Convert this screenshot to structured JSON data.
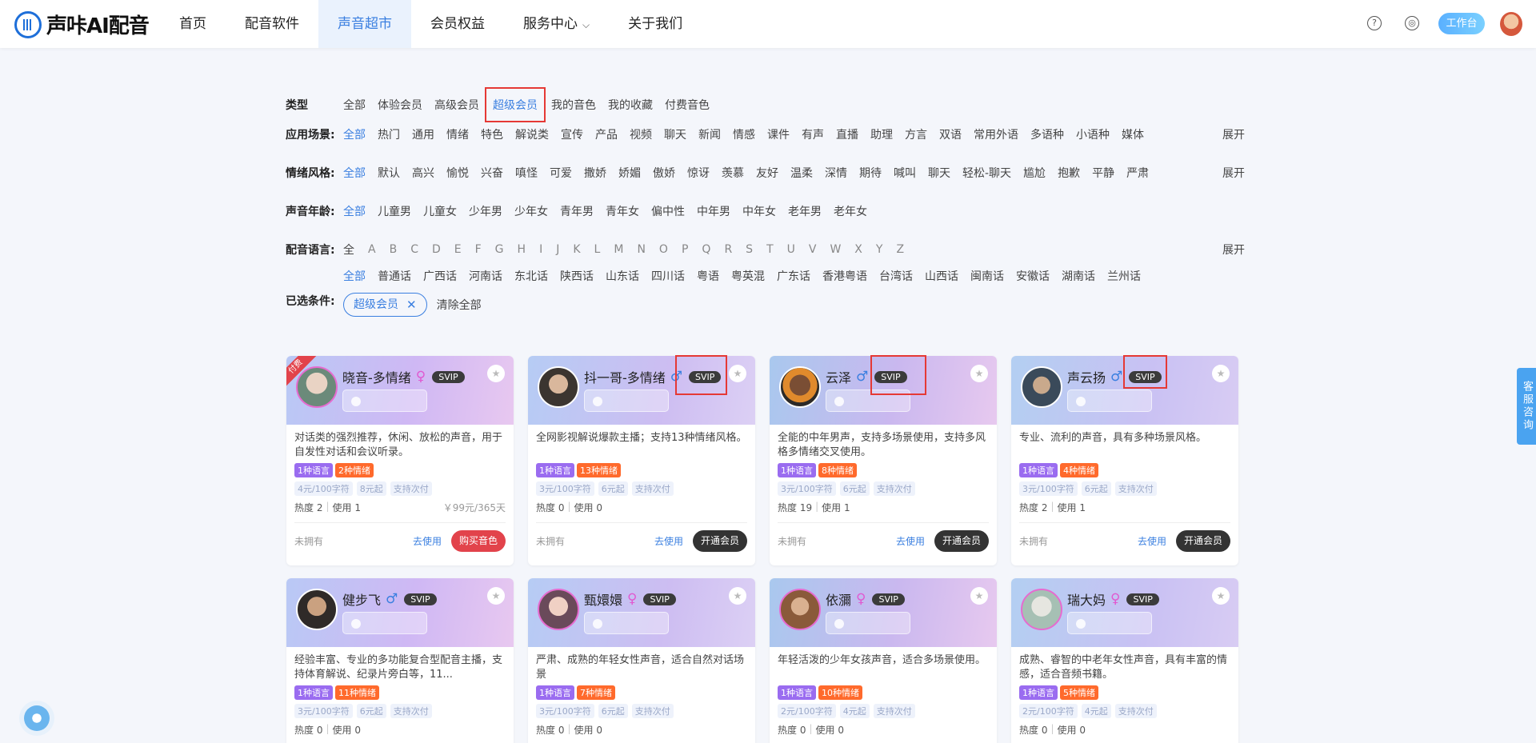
{
  "header": {
    "logo_text": "声咔AI配音",
    "nav": [
      {
        "label": "首页"
      },
      {
        "label": "配音软件"
      },
      {
        "label": "声音超市",
        "active": true
      },
      {
        "label": "会员权益"
      },
      {
        "label": "服务中心"
      },
      {
        "label": "关于我们"
      }
    ],
    "workbench_label": "工作台",
    "help_icon": "question-circle-icon",
    "message_icon": "settings-circle-icon"
  },
  "filters": {
    "type": {
      "label": "类型",
      "options": [
        "全部",
        "体验会员",
        "高级会员",
        "超级会员",
        "我的音色",
        "我的收藏",
        "付费音色"
      ],
      "selected": "超级会员"
    },
    "scene": {
      "label": "应用场景:",
      "options": [
        "全部",
        "热门",
        "通用",
        "情绪",
        "特色",
        "解说类",
        "宣传",
        "产品",
        "视频",
        "聊天",
        "新闻",
        "情感",
        "课件",
        "有声",
        "直播",
        "助理",
        "方言",
        "双语",
        "常用外语",
        "多语种",
        "小语种",
        "媒体"
      ],
      "selected": "全部"
    },
    "emotion": {
      "label": "情绪风格:",
      "options": [
        "全部",
        "默认",
        "高兴",
        "愉悦",
        "兴奋",
        "嗔怪",
        "可爱",
        "撒娇",
        "娇媚",
        "傲娇",
        "惊讶",
        "羡慕",
        "友好",
        "温柔",
        "深情",
        "期待",
        "喊叫",
        "聊天",
        "轻松-聊天",
        "尴尬",
        "抱歉",
        "平静",
        "严肃"
      ],
      "selected": "全部"
    },
    "age": {
      "label": "声音年龄:",
      "options": [
        "全部",
        "儿童男",
        "儿童女",
        "少年男",
        "少年女",
        "青年男",
        "青年女",
        "偏中性",
        "中年男",
        "中年女",
        "老年男",
        "老年女"
      ],
      "selected": "全部"
    },
    "language": {
      "label": "配音语言:",
      "letters": [
        "全",
        "A",
        "B",
        "C",
        "D",
        "E",
        "F",
        "G",
        "H",
        "I",
        "J",
        "K",
        "L",
        "M",
        "N",
        "O",
        "P",
        "Q",
        "R",
        "S",
        "T",
        "U",
        "V",
        "W",
        "X",
        "Y",
        "Z"
      ],
      "dialects": [
        "全部",
        "普通话",
        "广西话",
        "河南话",
        "东北话",
        "陕西话",
        "山东话",
        "四川话",
        "粤语",
        "粤英混",
        "广东话",
        "香港粤语",
        "台湾话",
        "山西话",
        "闽南话",
        "安徽话",
        "湖南话",
        "兰州话"
      ],
      "selected_dialect": "全部"
    },
    "expand_label": "展开",
    "selected_label": "已选条件:",
    "selected_chip": "超级会员",
    "clear_label": "清除全部"
  },
  "cards": [
    {
      "name": "晓音-多情绪",
      "gender": "♀",
      "badge": "SVIP",
      "paid_ribbon": "付费",
      "desc": "对话类的强烈推荐，休闲、放松的声音，用于自发性对话和会议听录。",
      "lang_tag": "1种语言",
      "emo_tag": "2种情绪",
      "price1": "4元/100字符",
      "price2": "8元起",
      "price3": "支持次付",
      "hot": "热度 2",
      "use": "使用 1",
      "year_price": "￥99元/365天",
      "owned": "未拥有",
      "use_link": "去使用",
      "action": "购买音色",
      "action_type": "buy"
    },
    {
      "name": "抖一哥-多情绪",
      "gender": "♂",
      "badge": "SVIP",
      "desc": "全网影视解说爆款主播；支持13种情绪风格。",
      "lang_tag": "1种语言",
      "emo_tag": "13种情绪",
      "price1": "3元/100字符",
      "price2": "6元起",
      "price3": "支持次付",
      "hot": "热度 0",
      "use": "使用 0",
      "owned": "未拥有",
      "use_link": "去使用",
      "action": "开通会员",
      "action_type": "vip"
    },
    {
      "name": "云泽",
      "gender": "♂",
      "badge": "SVIP",
      "desc": "全能的中年男声，支持多场景使用，支持多风格多情绪交叉使用。",
      "lang_tag": "1种语言",
      "emo_tag": "8种情绪",
      "price1": "3元/100字符",
      "price2": "6元起",
      "price3": "支持次付",
      "hot": "热度 19",
      "use": "使用 1",
      "owned": "未拥有",
      "use_link": "去使用",
      "action": "开通会员",
      "action_type": "vip"
    },
    {
      "name": "声云扬",
      "gender": "♂",
      "badge": "SVIP",
      "desc": "专业、流利的声音，具有多种场景风格。",
      "lang_tag": "1种语言",
      "emo_tag": "4种情绪",
      "price1": "3元/100字符",
      "price2": "6元起",
      "price3": "支持次付",
      "hot": "热度 2",
      "use": "使用 1",
      "owned": "未拥有",
      "use_link": "去使用",
      "action": "开通会员",
      "action_type": "vip"
    },
    {
      "name": "健步飞",
      "gender": "♂",
      "badge": "SVIP",
      "desc": "经验丰富、专业的多功能复合型配音主播，支持体育解说、纪录片旁白等，11...",
      "lang_tag": "1种语言",
      "emo_tag": "11种情绪",
      "price1": "3元/100字符",
      "price2": "6元起",
      "price3": "支持次付",
      "hot": "热度 0",
      "use": "使用 0"
    },
    {
      "name": "甄嬛嬛",
      "gender": "♀",
      "badge": "SVIP",
      "desc": "严肃、成熟的年轻女性声音，适合自然对话场景",
      "lang_tag": "1种语言",
      "emo_tag": "7种情绪",
      "price1": "3元/100字符",
      "price2": "6元起",
      "price3": "支持次付",
      "hot": "热度 0",
      "use": "使用 0"
    },
    {
      "name": "依瀰",
      "gender": "♀",
      "badge": "SVIP",
      "desc": "年轻活泼的少年女孩声音，适合多场景使用。",
      "lang_tag": "1种语言",
      "emo_tag": "10种情绪",
      "price1": "2元/100字符",
      "price2": "4元起",
      "price3": "支持次付",
      "hot": "热度 0",
      "use": "使用 0"
    },
    {
      "name": "瑞大妈",
      "gender": "♀",
      "badge": "SVIP",
      "desc": "成熟、睿智的中老年女性声音，具有丰富的情感，适合音频书籍。",
      "lang_tag": "1种语言",
      "emo_tag": "5种情绪",
      "price1": "2元/100字符",
      "price2": "4元起",
      "price3": "支持次付",
      "hot": "热度 0",
      "use": "使用 0"
    }
  ],
  "side": {
    "kefu_label": "客服咨询"
  }
}
